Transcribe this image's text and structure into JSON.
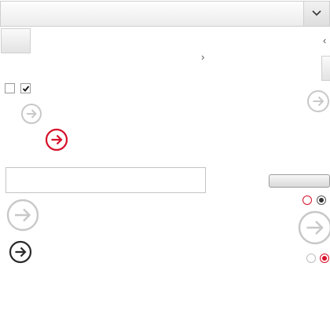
{
  "colors": {
    "accent": "#d7102a",
    "disabled": "#c8c8c8",
    "dark": "#2a2a2a"
  },
  "icons": {
    "dropdown": "chevron-down-icon",
    "next": "chevron-right-icon",
    "prev": "chevron-left-icon",
    "arrow": "arrow-right-circle-icon",
    "check": "check-icon"
  },
  "checkboxes": [
    {
      "checked": false
    },
    {
      "checked": true
    }
  ],
  "radios_dark": [
    {
      "selected": false
    },
    {
      "selected": true
    }
  ],
  "radios_red": [
    {
      "selected": false
    },
    {
      "selected": true
    }
  ]
}
